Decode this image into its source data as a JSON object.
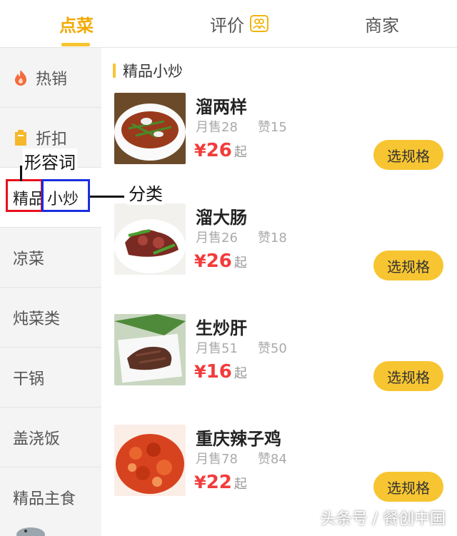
{
  "tabs": [
    {
      "label": "点菜",
      "active": true
    },
    {
      "label": "评价",
      "icon": "review-people-icon"
    },
    {
      "label": "商家"
    }
  ],
  "sidebar": {
    "items": [
      {
        "label": "热销",
        "icon": "fire-icon"
      },
      {
        "label": "折扣",
        "icon": "discount-tag-icon"
      },
      {
        "label": "精品小炒",
        "part1": "精品",
        "part2": "小炒",
        "active": true
      },
      {
        "label": "凉菜"
      },
      {
        "label": "炖菜类"
      },
      {
        "label": "干锅"
      },
      {
        "label": "盖浇饭"
      },
      {
        "label": "精品主食"
      }
    ]
  },
  "main": {
    "section_title": "精品小炒",
    "dishes": [
      {
        "name": "溜两样",
        "monthly": "月售28",
        "likes": "赞15",
        "currency": "¥",
        "price": "26",
        "suffix": "起",
        "button": "选规格"
      },
      {
        "name": "溜大肠",
        "monthly": "月售26",
        "likes": "赞18",
        "currency": "¥",
        "price": "26",
        "suffix": "起",
        "button": "选规格"
      },
      {
        "name": "生炒肝",
        "monthly": "月售51",
        "likes": "赞50",
        "currency": "¥",
        "price": "16",
        "suffix": "起",
        "button": "选规格"
      },
      {
        "name": "重庆辣子鸡",
        "monthly": "月售78",
        "likes": "赞84",
        "currency": "¥",
        "price": "22",
        "suffix": "起",
        "button": "选规格"
      }
    ]
  },
  "annotations": {
    "adjective": "形容词",
    "category": "分类"
  },
  "watermark": "头条号 / 餐创中国",
  "colors": {
    "accent": "#f7c531",
    "price": "#f23c3c",
    "annotation_red": "#e8101d",
    "annotation_blue": "#1a2ee0"
  }
}
